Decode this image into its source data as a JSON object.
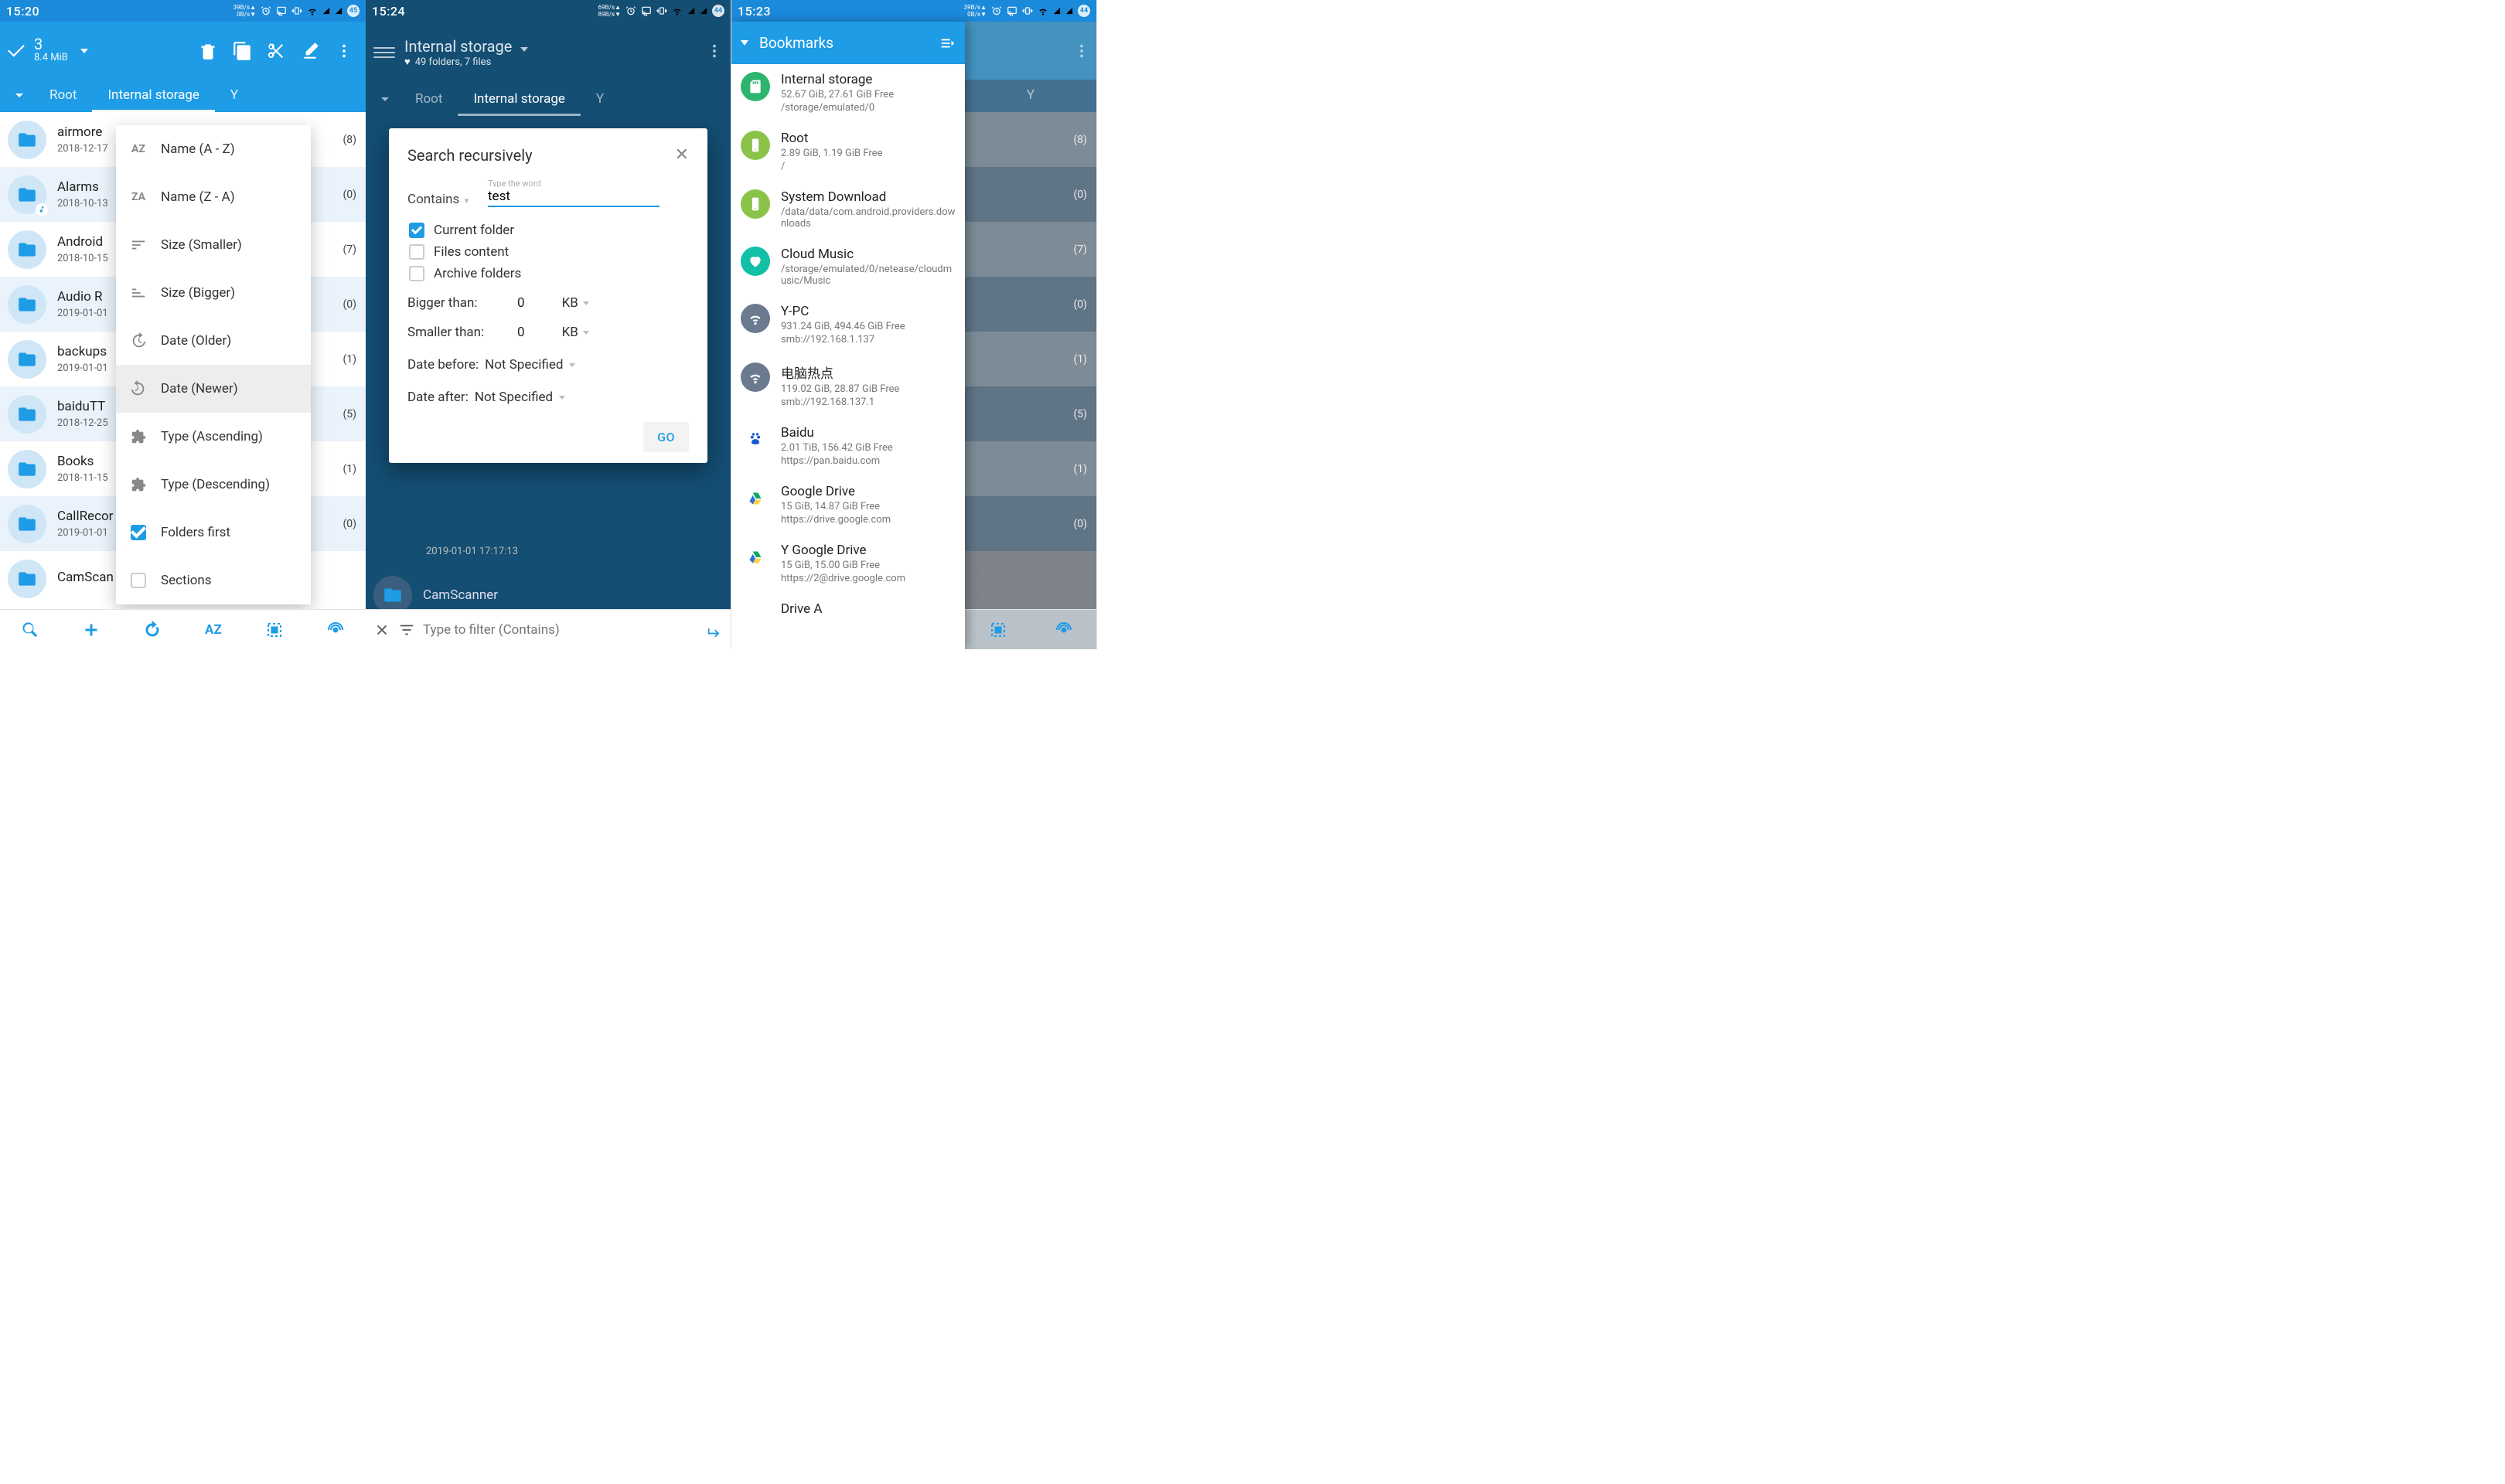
{
  "statusbar": {
    "time1": "15:20",
    "time2": "15:24",
    "time3": "15:23",
    "speed1_up": "39B/s",
    "speed1_dn": "0B/s",
    "speed2_up": "69B/s",
    "speed2_dn": "89B/s",
    "speed3_up": "39B/s",
    "speed3_dn": "0B/s",
    "badge1": "45",
    "badge2": "44",
    "badge3": "44"
  },
  "panel1": {
    "selected_count": "3",
    "selected_size": "8.4 MiB",
    "crumbs": {
      "root": "Root",
      "internal": "Internal storage",
      "y": "Y"
    },
    "rows": [
      {
        "name": "airmore",
        "date": "2018-12-17",
        "count": "(8)",
        "alt": false
      },
      {
        "name": "Alarms",
        "date": "2018-10-13",
        "count": "(0)",
        "alt": true,
        "music": true
      },
      {
        "name": "Android",
        "date": "2018-10-15",
        "count": "(7)",
        "alt": false
      },
      {
        "name": "Audio R",
        "date": "2019-01-01",
        "count": "(0)",
        "alt": true
      },
      {
        "name": "backups",
        "date": "2019-01-01",
        "count": "(1)",
        "alt": false
      },
      {
        "name": "baiduTT",
        "date": "2018-12-25",
        "count": "(5)",
        "alt": true
      },
      {
        "name": "Books",
        "date": "2018-11-15",
        "count": "(1)",
        "alt": false
      },
      {
        "name": "CallRecor",
        "date": "2019-01-01",
        "count": "(0)",
        "alt": true
      },
      {
        "name": "CamScan",
        "date": "",
        "count": "",
        "alt": false
      }
    ],
    "sort": {
      "name_az": "Name (A - Z)",
      "name_za": "Name (Z - A)",
      "size_sm": "Size (Smaller)",
      "size_bg": "Size (Bigger)",
      "date_old": "Date (Older)",
      "date_new": "Date (Newer)",
      "type_asc": "Type (Ascending)",
      "type_desc": "Type (Descending)",
      "folders_first": "Folders first",
      "sections": "Sections",
      "az_label": "AZ",
      "za_label": "ZA"
    }
  },
  "panel2": {
    "crumbs": {
      "root": "Root",
      "internal": "Internal storage",
      "y": "Y"
    },
    "header": {
      "title": "Internal storage",
      "sub": "49 folders, 7 files"
    },
    "dialog": {
      "title": "Search recursively",
      "contains_label": "Contains",
      "contains_hint": "Type the word",
      "contains_value": "test",
      "current_folder": "Current folder",
      "files_content": "Files content",
      "archive_folders": "Archive folders",
      "bigger_label": "Bigger than:",
      "smaller_label": "Smaller than:",
      "zero": "0",
      "kb": "KB",
      "date_before": "Date before:",
      "date_after": "Date after:",
      "not_specified": "Not Specified",
      "go": "GO"
    },
    "under_row": {
      "date": "2019-01-01 17:17:13",
      "name": "CamScanner"
    },
    "filter_placeholder": "Type to filter (Contains)"
  },
  "panel3": {
    "crumbs": {
      "y": "Y"
    },
    "title": "Bookmarks",
    "bookmarks": [
      {
        "icon": "sd",
        "color": "#2db46d",
        "name": "Internal storage",
        "size": "52.67 GiB,  27.61 GiB Free",
        "path": "/storage/emulated/0"
      },
      {
        "icon": "phone",
        "color": "#8bc34a",
        "name": "Root",
        "size": "2.89 GiB,  1.19 GiB Free",
        "path": "/"
      },
      {
        "icon": "phone",
        "color": "#8bc34a",
        "name": "System Download",
        "size": "",
        "path": "/data/data/com.android.providers.downloads"
      },
      {
        "icon": "heart",
        "color": "#13bfa6",
        "name": "Cloud Music",
        "size": "",
        "path": "/storage/emulated/0/netease/cloudmusic/Music"
      },
      {
        "icon": "wifi",
        "color": "#6b7a8f",
        "name": "Y-PC",
        "size": "931.24 GiB,  494.46 GiB Free",
        "path": "smb://192.168.1.137"
      },
      {
        "icon": "wifi",
        "color": "#6b7a8f",
        "name": "电脑热点",
        "size": "119.02 GiB,  28.87 GiB Free",
        "path": "smb://192.168.137.1"
      },
      {
        "icon": "paw",
        "color": "#ffffff",
        "name": "Baidu",
        "size": "2.01 TiB,  156.42 GiB Free",
        "path": "https://pan.baidu.com"
      },
      {
        "icon": "gdrive",
        "color": "#ffffff",
        "name": "Google Drive",
        "size": "15 GiB,  14.87 GiB Free",
        "path": "https://drive.google.com"
      },
      {
        "icon": "gdrive",
        "color": "#ffffff",
        "name": "Y Google Drive",
        "size": "15 GiB,  15.00 GiB Free",
        "path": "https://2@drive.google.com"
      },
      {
        "icon": "blank",
        "color": "#ffffff",
        "name": "Drive A",
        "size": "",
        "path": ""
      }
    ],
    "counts": [
      "(8)",
      "(0)",
      "(7)",
      "(0)",
      "(1)",
      "(5)",
      "(1)",
      "(0)"
    ]
  }
}
